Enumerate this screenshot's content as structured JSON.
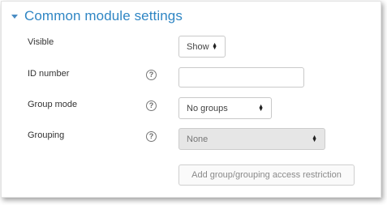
{
  "section": {
    "title": "Common module settings",
    "expanded": true
  },
  "fields": {
    "visible": {
      "label": "Visible",
      "value": "Show"
    },
    "id_number": {
      "label": "ID number",
      "help": "?",
      "value": ""
    },
    "group_mode": {
      "label": "Group mode",
      "help": "?",
      "value": "No groups"
    },
    "grouping": {
      "label": "Grouping",
      "help": "?",
      "value": "None",
      "disabled": true
    }
  },
  "actions": {
    "add_restriction_label": "Add group/grouping access restriction"
  },
  "colors": {
    "accent": "#2f86c4",
    "disabled_bg": "#e6e6e6"
  }
}
